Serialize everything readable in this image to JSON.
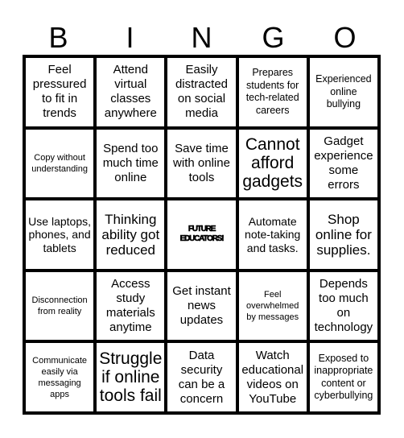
{
  "header": {
    "letters": [
      "B",
      "I",
      "N",
      "G",
      "O"
    ]
  },
  "grid": {
    "rows": [
      [
        "Feel pressured to fit in trends",
        "Attend virtual classes anywhere",
        "Easily distracted on social media",
        "Prepares students for tech-related careers",
        "Experienced online bullying"
      ],
      [
        "Copy without understanding",
        "Spend too much time online",
        "Save time with online tools",
        "Cannot afford gadgets",
        "Gadget experience some errors"
      ],
      [
        "Use laptops, phones, and tablets",
        "Thinking ability got reduced",
        "FUTURE EDUCATORS!",
        "Automate note-taking and tasks.",
        "Shop online for supplies."
      ],
      [
        "Disconnection from reality",
        "Access study materials anytime",
        "Get instant news updates",
        "Feel overwhelmed by messages",
        "Depends too much on technology"
      ],
      [
        "Communicate easily via messaging apps",
        "Struggle if online tools fail",
        "Data security can be a concern",
        "Watch educational videos on YouTube",
        "Exposed to inappropriate content or cyberbullying"
      ]
    ],
    "free_space": "FUTURE EDUCATORS!"
  }
}
